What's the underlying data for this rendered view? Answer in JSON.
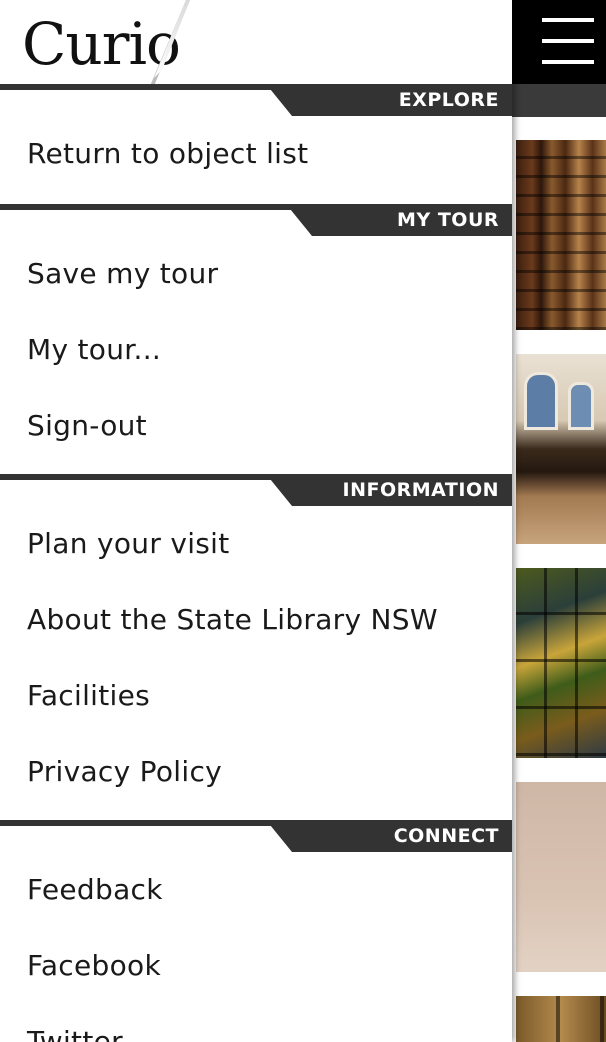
{
  "app": {
    "logo_text": "Curio"
  },
  "menu": {
    "sections": [
      {
        "title": "EXPLORE",
        "items": [
          "Return to object list"
        ]
      },
      {
        "title": "MY TOUR",
        "items": [
          "Save my tour",
          "My tour...",
          "Sign-out"
        ]
      },
      {
        "title": "INFORMATION",
        "items": [
          "Plan your visit",
          "About the State Library NSW",
          "Facilities",
          "Privacy Policy"
        ]
      },
      {
        "title": "CONNECT",
        "items": [
          "Feedback",
          "Facebook",
          "Twitter"
        ]
      }
    ]
  },
  "icons": {
    "menu": "hamburger-icon"
  },
  "colors": {
    "section_bar": "#333333",
    "header_bg": "#000000",
    "text": "#1a1a1a"
  }
}
